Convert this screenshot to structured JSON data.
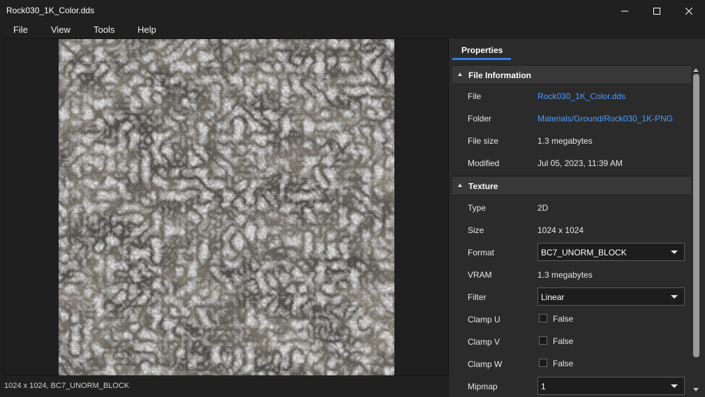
{
  "window": {
    "title": "Rock030_1K_Color.dds",
    "minimize_icon": "minimize-icon",
    "maximize_icon": "maximize-icon",
    "close_icon": "close-icon"
  },
  "menu": [
    "File",
    "View",
    "Tools",
    "Help"
  ],
  "status": {
    "text": "1024 x 1024, BC7_UNORM_BLOCK"
  },
  "panel": {
    "tab": "Properties",
    "accent_color": "#2f7fe8",
    "link_color": "#4b9cff",
    "file_info": {
      "header": "File Information",
      "rows": [
        {
          "label": "File",
          "value": "Rock030_1K_Color.dds"
        },
        {
          "label": "Folder",
          "value": "Materials/Ground/Rock030_1K-PNG"
        },
        {
          "label": "File size",
          "value": "1.3 megabytes"
        },
        {
          "label": "Modified",
          "value": "Jul 05, 2023, 11:39 AM"
        }
      ]
    },
    "texture": {
      "header": "Texture",
      "type": {
        "label": "Type",
        "value": "2D"
      },
      "size": {
        "label": "Size",
        "value": "1024 x 1024"
      },
      "format": {
        "label": "Format",
        "value": "BC7_UNORM_BLOCK"
      },
      "vram": {
        "label": "VRAM",
        "value": "1.3 megabytes"
      },
      "filter": {
        "label": "Filter",
        "value": "Linear"
      },
      "clamp_u": {
        "label": "Clamp U",
        "value": "False"
      },
      "clamp_v": {
        "label": "Clamp V",
        "value": "False"
      },
      "clamp_w": {
        "label": "Clamp W",
        "value": "False"
      },
      "mipmap": {
        "label": "Mipmap",
        "value": "1"
      }
    }
  }
}
